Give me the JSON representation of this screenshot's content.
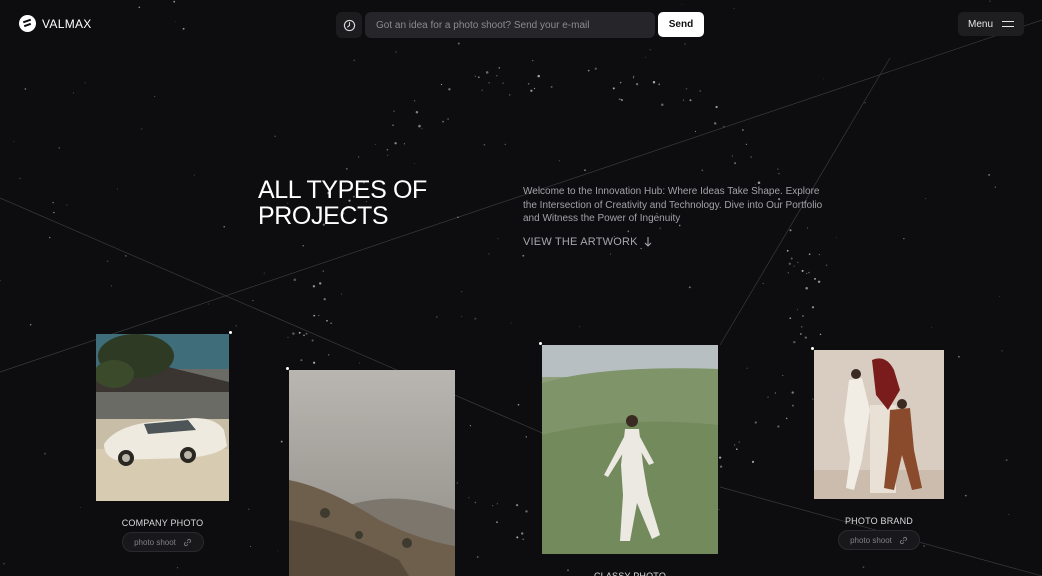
{
  "brand": {
    "name": "VALMAX"
  },
  "header": {
    "input_placeholder": "Got an idea for a photo shoot? Send your e-mail",
    "send_label": "Send",
    "menu_label": "Menu"
  },
  "hero": {
    "title_line1": "ALL TYPES OF",
    "title_line2": "PROJECTS",
    "description": "Welcome to the Innovation Hub: Where Ideas Take Shape. Explore the Intersection of Creativity and Technology. Dive into Our Portfolio and Witness the Power of Ingenuity",
    "cta_label": "VIEW THE ARTWORK",
    "cta_icon": "arrow-down-icon"
  },
  "projects": [
    {
      "title": "COMPANY PHOTO",
      "tag": "photo shoot"
    },
    {
      "title": "",
      "tag": ""
    },
    {
      "title": "CLASSY PHOTO",
      "tag": ""
    },
    {
      "title": "PHOTO BRAND",
      "tag": "photo shoot"
    }
  ],
  "colors": {
    "background": "#0d0d0f",
    "accent": "#ffffff",
    "muted": "#a2a2a8"
  }
}
